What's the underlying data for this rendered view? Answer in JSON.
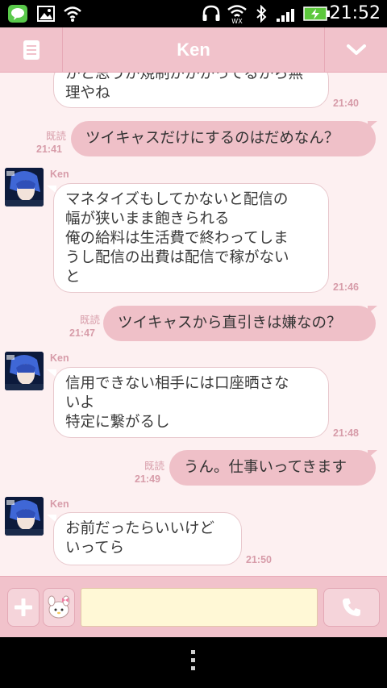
{
  "status_bar": {
    "time": "21:52",
    "icons": [
      "line-notification-icon",
      "gallery-notification-icon",
      "wifi-signal-icon",
      "headphones-icon",
      "wifi-icon",
      "bluetooth-icon",
      "cell-signal-icon",
      "battery-charging-icon"
    ]
  },
  "header": {
    "title": "Ken",
    "left_icon": "menu-list-icon",
    "right_icon": "chevron-down-icon"
  },
  "chat": {
    "contact_name": "Ken",
    "messages": [
      {
        "from": "Ken",
        "lines": [
          "かと思うが規制がかかってるから無",
          "理やね"
        ],
        "time": "21:40"
      },
      {
        "from": "me",
        "text": "ツイキャスだけにするのはだめなん？",
        "read": "既読",
        "time": "21:41"
      },
      {
        "from": "Ken",
        "sender": "Ken",
        "lines": [
          "マネタイズもしてかないと配信の",
          "幅が狭いまま飽きられる",
          "俺の給料は生活費で終わってしま",
          "うし配信の出費は配信で稼がない",
          "と"
        ],
        "time": "21:46"
      },
      {
        "from": "me",
        "text": "ツイキャスから直引きは嫌なの？",
        "read": "既読",
        "time": "21:47"
      },
      {
        "from": "Ken",
        "sender": "Ken",
        "lines": [
          "信用できない相手には口座晒さな",
          "いよ",
          "特定に繋がるし"
        ],
        "time": "21:48"
      },
      {
        "from": "me",
        "text": "うん。仕事いってきます",
        "read": "既読",
        "time": "21:49"
      },
      {
        "from": "Ken",
        "sender": "Ken",
        "lines": [
          "お前だったらいいけど",
          "いってら"
        ],
        "time": "21:50"
      }
    ]
  },
  "input_bar": {
    "placeholder": "",
    "add_icon": "plus-icon",
    "sticker_icon": "sticker-icon",
    "call_icon": "phone-icon"
  },
  "colors": {
    "accent_pink": "#f1c2cb",
    "chat_background": "#fdf0f1",
    "outgoing_bubble": "#efc0c8",
    "input_field": "#fff8d6",
    "timestamp": "#d79ca9"
  }
}
